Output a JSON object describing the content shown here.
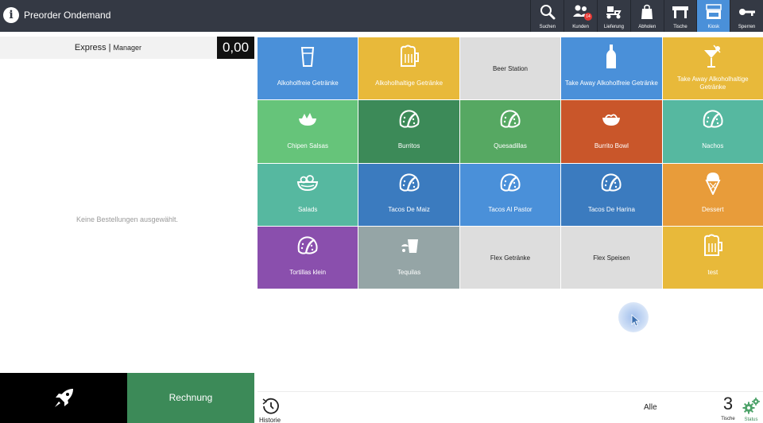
{
  "app": {
    "title": "Preorder Ondemand"
  },
  "toolbar": {
    "items": [
      {
        "label": "Suchen",
        "icon": "search-icon"
      },
      {
        "label": "Kunden",
        "icon": "customers-icon",
        "badge": "14"
      },
      {
        "label": "Lieferung",
        "icon": "delivery-scooter-icon"
      },
      {
        "label": "Abholen",
        "icon": "shopping-bag-icon"
      },
      {
        "label": "Tische",
        "icon": "table-icon"
      },
      {
        "label": "Kiosk",
        "icon": "kiosk-icon",
        "active": true
      },
      {
        "label": "Sperren",
        "icon": "key-icon"
      }
    ]
  },
  "order": {
    "mode": "Express",
    "role": "Manager",
    "total": "0,00",
    "empty_message": "Keine Bestellungen ausgewählt."
  },
  "actions": {
    "launch_icon": "rocket-icon",
    "bill_label": "Rechnung"
  },
  "categories": [
    {
      "label": "Alkoholfreie Getränke",
      "color": "#4a90d9",
      "icon": "glass-icon"
    },
    {
      "label": "Alkoholhaltige Getränke",
      "color": "#e8b93a",
      "icon": "beer-mug-icon"
    },
    {
      "label": "Beer Station",
      "color": "#dddddd",
      "icon": ""
    },
    {
      "label": "Take Away Alkoholfreie Getränke",
      "color": "#4a90d9",
      "icon": "bottle-icon"
    },
    {
      "label": "Take Away Alkoholhaltige Getränke",
      "color": "#e8b93a",
      "icon": "cocktail-icon"
    },
    {
      "label": "Chipen Salsas",
      "color": "#66c47a",
      "icon": "chips-bowl-icon"
    },
    {
      "label": "Burritos",
      "color": "#3c8a58",
      "icon": "taco-icon"
    },
    {
      "label": "Quesadillas",
      "color": "#56a862",
      "icon": "taco-icon"
    },
    {
      "label": "Burrito Bowl",
      "color": "#c9562a",
      "icon": "bowl-icon"
    },
    {
      "label": "Nachos",
      "color": "#56b8a0",
      "icon": "taco-icon"
    },
    {
      "label": "Salads",
      "color": "#56b8a0",
      "icon": "salad-icon"
    },
    {
      "label": "Tacos De Maiz",
      "color": "#3b7bbf",
      "icon": "taco-icon"
    },
    {
      "label": "Tacos Al Pastor",
      "color": "#4a90d9",
      "icon": "taco-icon"
    },
    {
      "label": "Tacos De Harina",
      "color": "#3b7bbf",
      "icon": "taco-icon"
    },
    {
      "label": "Dessert",
      "color": "#e89c3a",
      "icon": "ice-cream-icon"
    },
    {
      "label": "Tortillas klein",
      "color": "#8a4fad",
      "icon": "taco-icon"
    },
    {
      "label": "Tequilas",
      "color": "#95a5a6",
      "icon": "shot-glass-icon"
    },
    {
      "label": "Flex Getränke",
      "color": "#dddddd",
      "icon": ""
    },
    {
      "label": "Flex Speisen",
      "color": "#dddddd",
      "icon": ""
    },
    {
      "label": "test",
      "color": "#e8b93a",
      "icon": "beer-mug-icon"
    }
  ],
  "footer": {
    "history_label": "Historie",
    "filter_label": "Alle",
    "tables_count": "3",
    "tables_label": "Tische",
    "status_label": "Status"
  }
}
